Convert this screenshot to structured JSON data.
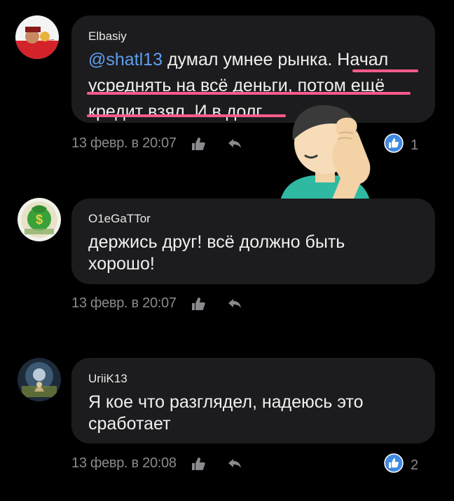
{
  "comments": [
    {
      "author": "Elbasiy",
      "mention": "@shatl13",
      "text_line1": " думал умнее рынка. Начал",
      "text_line2": "усреднять на всё деньги, потом ещё",
      "text_line3": "кредит взял. И в долг.",
      "timestamp": "13 февр. в 20:07",
      "likes": "1"
    },
    {
      "author": "O1eGaTTor",
      "text_line1": "держись друг! всё должно быть",
      "text_line2": "хорошо!",
      "timestamp": "13 февр. в 20:07",
      "likes": ""
    },
    {
      "author": "UriiK13",
      "text_line1": "Я кое что разглядел, надеюсь это",
      "text_line2": "сработает",
      "timestamp": "13 февр. в 20:08",
      "likes": "2"
    }
  ],
  "colors": {
    "background": "#000000",
    "bubble": "#1c1c1e",
    "mention": "#5d9ff0",
    "underline_annotation": "#ff5b8c",
    "like_badge": "#3f8ae0"
  },
  "icons": [
    "avatar",
    "thumbs-up-icon",
    "reply-arrow-icon",
    "like-badge-icon",
    "facepalm-emoji"
  ]
}
